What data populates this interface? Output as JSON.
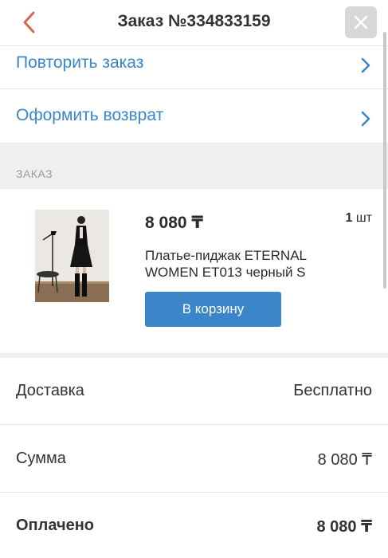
{
  "header": {
    "title": "Заказ №334833159",
    "back_icon": "chevron-left-icon",
    "close_icon": "close-icon"
  },
  "actions": {
    "repeat_label": "Повторить заказ",
    "return_label": "Оформить возврат"
  },
  "section": {
    "label": "ЗАКАЗ"
  },
  "product": {
    "price": "8 080 ₸",
    "qty_number": "1",
    "qty_unit": "шт",
    "name": "Платье-пиджак ETERNAL WOMEN ET013 черный S",
    "cart_button": "В корзину"
  },
  "summary": {
    "delivery_label": "Доставка",
    "delivery_value": "Бесплатно",
    "sum_label": "Сумма",
    "sum_value": "8 080 ₸",
    "paid_label": "Оплачено",
    "paid_value": "8 080 ₸"
  },
  "colors": {
    "accent": "#3a86c8",
    "back_arrow": "#d9664f",
    "section_bg": "#efefef"
  }
}
